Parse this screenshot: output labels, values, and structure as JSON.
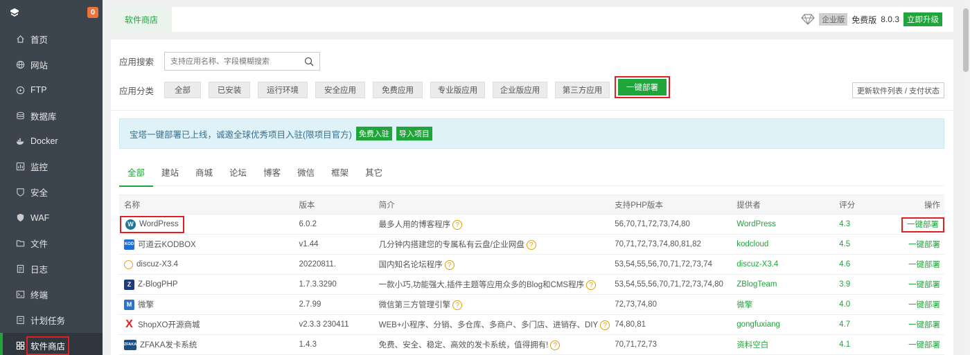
{
  "sidebar": {
    "badge": "0",
    "items": [
      {
        "label": "首页",
        "icon": "home-icon"
      },
      {
        "label": "网站",
        "icon": "globe-icon"
      },
      {
        "label": "FTP",
        "icon": "ftp-icon"
      },
      {
        "label": "数据库",
        "icon": "database-icon"
      },
      {
        "label": "Docker",
        "icon": "docker-icon"
      },
      {
        "label": "监控",
        "icon": "monitor-icon"
      },
      {
        "label": "安全",
        "icon": "security-icon"
      },
      {
        "label": "WAF",
        "icon": "shield-icon"
      },
      {
        "label": "文件",
        "icon": "folder-icon"
      },
      {
        "label": "日志",
        "icon": "log-icon"
      },
      {
        "label": "终端",
        "icon": "terminal-icon"
      },
      {
        "label": "计划任务",
        "icon": "clock-icon"
      },
      {
        "label": "软件商店",
        "icon": "apps-icon"
      }
    ]
  },
  "topbar": {
    "tab": "软件商店",
    "edition_tag": "企业版",
    "edition": "免费版",
    "version": "8.0.3",
    "upgrade": "立即升级"
  },
  "search": {
    "label": "应用搜索",
    "placeholder": "支持应用名称、字段模糊搜索"
  },
  "category": {
    "label": "应用分类",
    "buttons": [
      "全部",
      "已安装",
      "运行环境",
      "安全应用",
      "免费应用",
      "专业版应用",
      "企业版应用",
      "第三方应用",
      "一键部署"
    ],
    "refresh": "更新软件列表 / 支付状态"
  },
  "banner": {
    "text": "宝塔一键部署已上线，诚邀全球优秀项目入驻(限项目官方)",
    "btn1": "免费入驻",
    "btn2": "导入项目"
  },
  "subtabs": [
    "全部",
    "建站",
    "商城",
    "论坛",
    "博客",
    "微信",
    "框架",
    "其它"
  ],
  "table": {
    "headers": [
      "名称",
      "版本",
      "简介",
      "支持PHP版本",
      "提供者",
      "评分",
      "操作"
    ],
    "rows": [
      {
        "name": "WordPress",
        "version": "6.0.2",
        "desc": "最多人用的博客程序",
        "php": "56,70,71,72,73,74,80",
        "provider": "WordPress",
        "score": "4.3",
        "op": "一键部署"
      },
      {
        "name": "可道云KODBOX",
        "version": "v1.44",
        "desc": "几分钟内搭建您的专属私有云盘/企业网盘",
        "php": "70,71,72,73,74,80,81,82",
        "provider": "kodcloud",
        "score": "4.5",
        "op": "一键部署"
      },
      {
        "name": "discuz-X3.4",
        "version": "20220811.",
        "desc": "国内知名论坛程序",
        "php": "53,54,55,56,70,71,72,73,74",
        "provider": "discuz-X3.4",
        "score": "4.6",
        "op": "一键部署"
      },
      {
        "name": "Z-BlogPHP",
        "version": "1.7.3.3290",
        "desc": "一款小巧,功能强大,插件主题等应用众多的Blog和CMS程序",
        "php": "53,54,55,56,70,71,72,73,74,80",
        "provider": "ZBlogTeam",
        "score": "3.9",
        "op": "一键部署"
      },
      {
        "name": "微擎",
        "version": "2.7.99",
        "desc": "微信第三方管理引擎",
        "php": "72,73,74,80",
        "provider": "微擎",
        "score": "4.0",
        "op": "一键部署"
      },
      {
        "name": "ShopXO开源商城",
        "version": "v2.3.3 230411",
        "desc": "WEB+小程序、分销、多仓库、多商户、多门店、进销存、DIY",
        "php": "74,80,81",
        "provider": "gongfuxiang",
        "score": "4.7",
        "op": "一键部署"
      },
      {
        "name": "ZFAKA发卡系统",
        "version": "1.4.3",
        "desc": "免费、安全、稳定、高效的发卡系统，值得拥有!",
        "php": "70,71,72,73",
        "provider": "资料空白",
        "score": "4.1",
        "op": "一键部署"
      }
    ]
  }
}
